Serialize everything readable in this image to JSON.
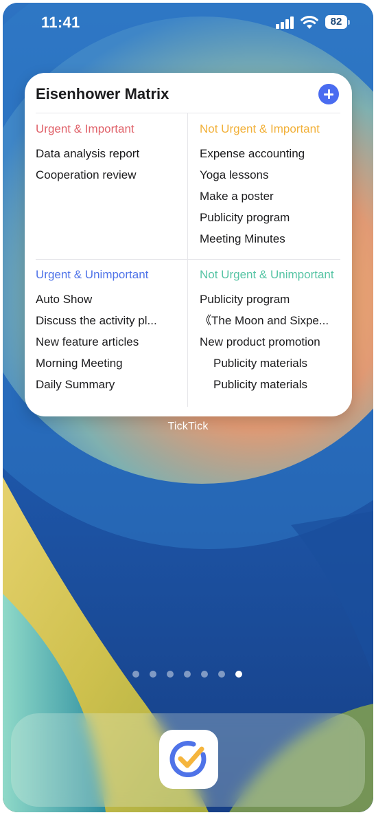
{
  "status_bar": {
    "time": "11:41",
    "battery": "82"
  },
  "widget": {
    "title": "Eisenhower Matrix",
    "app_name": "TickTick",
    "quadrants": [
      {
        "title": "Urgent & Important",
        "color": "#e0626a",
        "tasks": [
          "Data analysis report",
          "Cooperation review"
        ]
      },
      {
        "title": "Not Urgent & Important",
        "color": "#f2b13a",
        "tasks": [
          "Expense accounting",
          "Yoga lessons",
          "Make a poster",
          "Publicity program",
          "Meeting Minutes"
        ]
      },
      {
        "title": "Urgent & Unimportant",
        "color": "#4f73e8",
        "tasks": [
          "Auto Show",
          "Discuss the activity pl...",
          "New feature articles",
          "Morning Meeting",
          "Daily Summary"
        ]
      },
      {
        "title": "Not Urgent & Unimportant",
        "color": "#56c4a4",
        "tasks": [
          "Publicity program",
          "《The Moon and Sixpe...",
          "New product promotion",
          "Publicity materials",
          "Publicity materials"
        ]
      }
    ]
  },
  "page_indicator": {
    "count": 7,
    "active_index": 6
  },
  "dock": {
    "apps": [
      "ticktick-app-icon"
    ]
  },
  "colors": {
    "accent": "#4a6cf0"
  }
}
